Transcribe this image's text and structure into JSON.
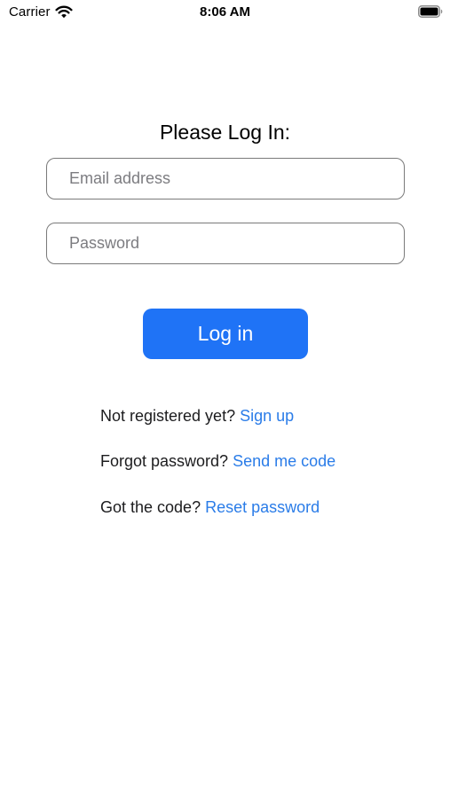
{
  "status_bar": {
    "carrier": "Carrier",
    "time": "8:06 AM",
    "wifi_icon": "wifi-icon",
    "battery_icon": "battery-icon"
  },
  "login": {
    "title": "Please Log In:",
    "email_placeholder": "Email address",
    "email_value": "",
    "password_placeholder": "Password",
    "password_value": "",
    "login_button": "Log in",
    "accent_color": "#1f73f6"
  },
  "links": {
    "signup_prompt": "Not registered yet?",
    "signup_link": "Sign up",
    "forgot_prompt": "Forgot password?",
    "forgot_link": "Send me code",
    "reset_prompt": "Got the code?",
    "reset_link": "Reset password",
    "link_color": "#2a7ce8"
  }
}
